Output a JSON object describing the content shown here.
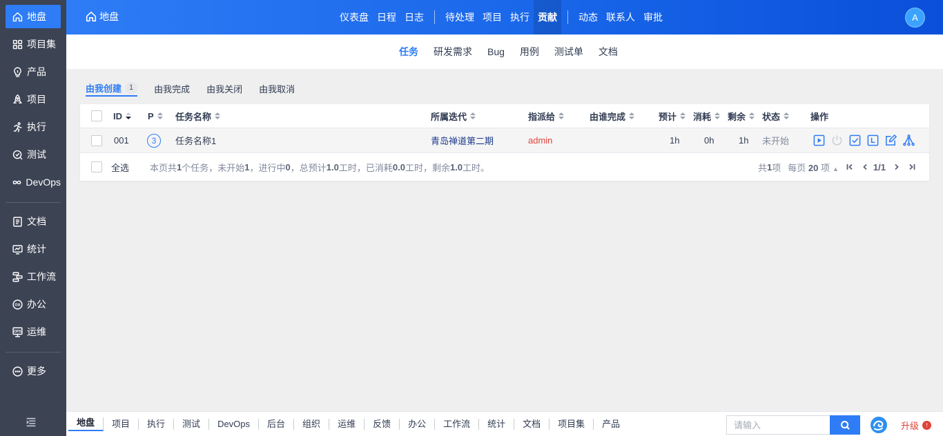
{
  "sidebar": {
    "items": [
      {
        "label": "地盘",
        "icon": "home-icon"
      },
      {
        "label": "项目集",
        "icon": "grid-icon"
      },
      {
        "label": "产品",
        "icon": "bulb-icon"
      },
      {
        "label": "项目",
        "icon": "rocket-icon"
      },
      {
        "label": "执行",
        "icon": "run-icon"
      },
      {
        "label": "测试",
        "icon": "test-icon"
      },
      {
        "label": "DevOps",
        "icon": "infinity-icon"
      },
      {
        "label": "文档",
        "icon": "doc-icon"
      },
      {
        "label": "统计",
        "icon": "chart-icon"
      },
      {
        "label": "工作流",
        "icon": "workflow-icon"
      },
      {
        "label": "办公",
        "icon": "oa-icon"
      },
      {
        "label": "运维",
        "icon": "ops-icon"
      },
      {
        "label": "更多",
        "icon": "more-icon"
      }
    ]
  },
  "header": {
    "title": "地盘",
    "nav": [
      "仪表盘",
      "日程",
      "日志",
      "待处理",
      "项目",
      "执行",
      "贡献",
      "动态",
      "联系人",
      "审批"
    ],
    "active": "贡献",
    "avatar": "A"
  },
  "subnav": {
    "tabs": [
      "任务",
      "研发需求",
      "Bug",
      "用例",
      "测试单",
      "文档"
    ],
    "active": "任务"
  },
  "filters": {
    "tabs": [
      "由我创建",
      "由我完成",
      "由我关闭",
      "由我取消"
    ],
    "active_count": "1"
  },
  "table": {
    "headers": {
      "id": "ID",
      "pri": "P",
      "name": "任务名称",
      "iteration": "所属迭代",
      "assigned": "指派给",
      "finished_by": "由谁完成",
      "estimate": "预计",
      "consumed": "消耗",
      "left": "剩余",
      "status": "状态",
      "actions": "操作"
    },
    "rows": [
      {
        "id": "001",
        "pri": "3",
        "name": "任务名称1",
        "iteration": "青岛禅道第二期",
        "assigned": "admin",
        "finished_by": "",
        "estimate": "1h",
        "consumed": "0h",
        "left": "1h",
        "status": "未开始"
      }
    ],
    "select_all": "全选",
    "summary": {
      "p1": "本页共 ",
      "total": "1",
      "p2": " 个任务，未开始 ",
      "wait": "1",
      "p3": "，进行中 ",
      "doing": "0",
      "p4": "，总预计 ",
      "estimate": "1.0",
      "p5": " 工时，已消耗 ",
      "consumed": "0.0",
      "p6": " 工时，剩余 ",
      "left": "1.0",
      "p7": " 工时。"
    },
    "pager": {
      "total_prefix": "共 ",
      "total": "1",
      "total_suffix": " 项",
      "per_page_prefix": "每页 ",
      "per_page": "20",
      "per_page_suffix": " 项",
      "page": "1/1"
    }
  },
  "bottombar": {
    "items": [
      "地盘",
      "项目",
      "执行",
      "测试",
      "DevOps",
      "后台",
      "组织",
      "运维",
      "反馈",
      "办公",
      "工作流",
      "统计",
      "文档",
      "项目集",
      "产品"
    ],
    "active": "地盘",
    "search_placeholder": "请输入",
    "upgrade": "升级"
  }
}
